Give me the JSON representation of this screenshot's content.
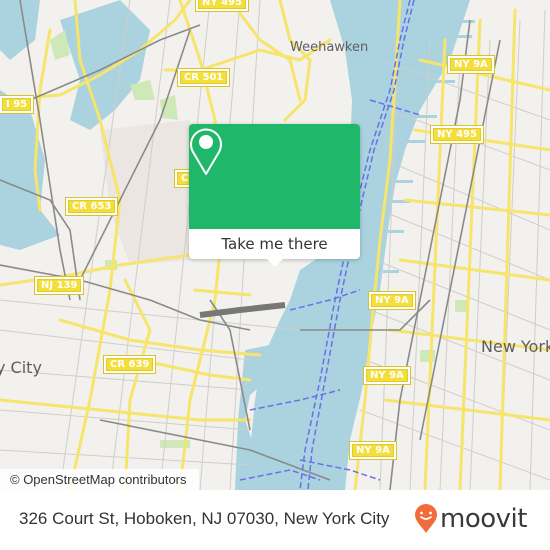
{
  "map": {
    "colors": {
      "land": "#f2f1ed",
      "water": "#aad3df",
      "park": "#cfe8b8",
      "major_road": "#f7e46b",
      "minor_road": "#c9c7c1",
      "rail": "#8a8a8a",
      "ferry": "#6870e8",
      "urban": "#e8e3df"
    },
    "place_labels": [
      {
        "name": "Weehawken"
      },
      {
        "name": "New York"
      },
      {
        "name": "y City"
      }
    ],
    "road_shields": [
      {
        "label": "I 95"
      },
      {
        "label": "CR 501"
      },
      {
        "label": "CR 653"
      },
      {
        "label": "C"
      },
      {
        "label": "NJ 139"
      },
      {
        "label": "CR 639"
      },
      {
        "label": "NY 9A"
      },
      {
        "label": "NY 495"
      },
      {
        "label": "NY 9A"
      },
      {
        "label": "NY 9A"
      },
      {
        "label": "NY 9A"
      },
      {
        "label": "NY 495"
      }
    ],
    "attribution": "© OpenStreetMap contributors"
  },
  "popup": {
    "icon": "location-pin-icon",
    "accent": "#1fb86a",
    "cta_label": "Take me there"
  },
  "footer": {
    "address": "326 Court St, Hoboken, NJ 07030, New York City",
    "brand_name": "moovit",
    "brand_icon": "moovit-pin-logo-icon",
    "brand_color": "#f26b3a"
  }
}
